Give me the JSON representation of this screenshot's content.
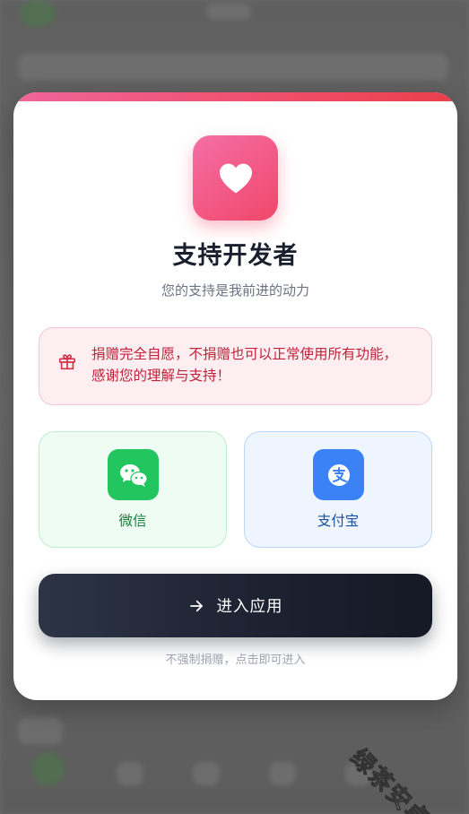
{
  "modal": {
    "title": "支持开发者",
    "subtitle": "您的支持是我前进的动力",
    "notice": "捐赠完全自愿，不捐赠也可以正常使用所有功能，感谢您的理解与支持！",
    "payments": {
      "wechat": {
        "label": "微信",
        "icon": "wechat-icon",
        "color": "#22c55e"
      },
      "alipay": {
        "label": "支付宝",
        "icon": "alipay-icon",
        "color": "#3b82f6"
      }
    },
    "enter_button": {
      "label": "进入应用",
      "icon": "arrow-right-icon"
    },
    "footnote": "不强制捐赠，点击即可进入"
  },
  "watermark": "绿茶安卓网",
  "colors": {
    "accent_pink": "#f0476a",
    "notice_text": "#c0213b",
    "button_dark": "#1c2130"
  }
}
